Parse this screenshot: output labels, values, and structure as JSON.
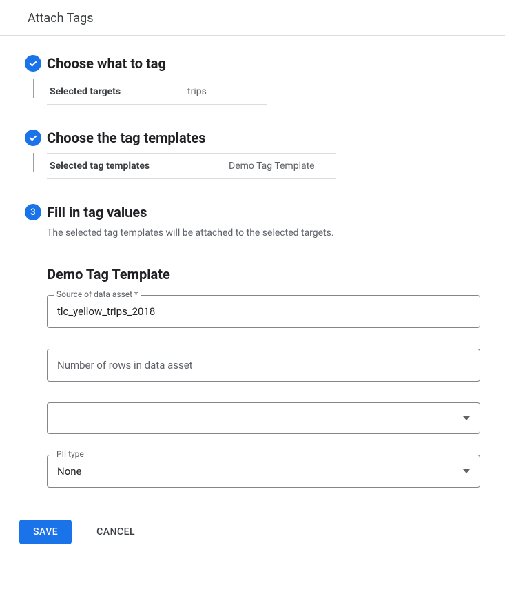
{
  "header": {
    "title": "Attach Tags"
  },
  "steps": {
    "s1": {
      "title": "Choose what to tag",
      "summary_label": "Selected targets",
      "summary_value": "trips"
    },
    "s2": {
      "title": "Choose the tag templates",
      "summary_label": "Selected tag templates",
      "summary_value": "Demo Tag Template"
    },
    "s3": {
      "number": "3",
      "title": "Fill in tag values",
      "description": "The selected tag templates will be attached to the selected targets."
    }
  },
  "form": {
    "template_title": "Demo Tag Template",
    "source": {
      "label": "Source of data asset *",
      "value": "tlc_yellow_trips_2018"
    },
    "rows": {
      "placeholder": "Number of rows in data asset",
      "value": ""
    },
    "unnamed_select": {
      "value": ""
    },
    "pii": {
      "label": "PII type",
      "value": "None"
    }
  },
  "actions": {
    "save": "SAVE",
    "cancel": "CANCEL"
  }
}
